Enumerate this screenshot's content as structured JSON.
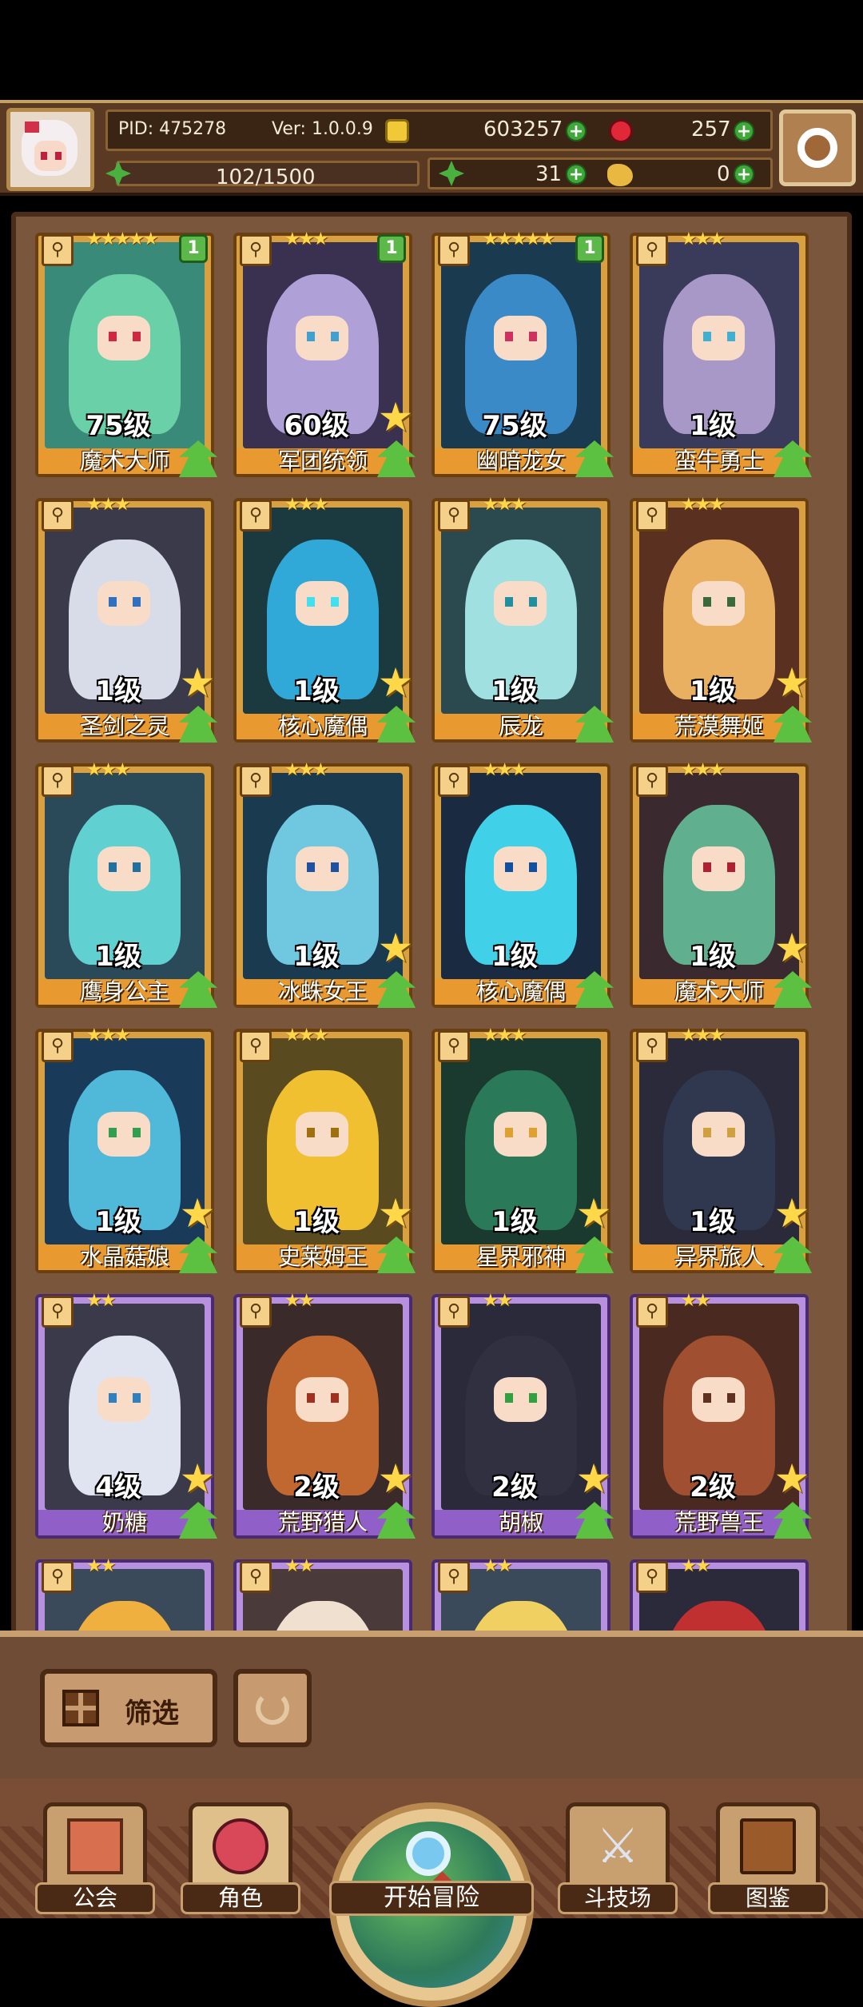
{
  "header": {
    "pid_label": "PID: 475278",
    "version_label": "Ver: 1.0.0.9",
    "gold": "603257",
    "gems": "257",
    "stamina": "102/1500",
    "clover_count": "31",
    "bread_count": "0"
  },
  "cards": [
    {
      "level": "75级",
      "name": "魔术大师",
      "stars": "★★★★★",
      "badge": "1",
      "rarity": "gold",
      "art_color": "#3a8a7a",
      "char_color": "#6ad0a8",
      "eye_color": "#d02840",
      "show_star": false
    },
    {
      "level": "60级",
      "name": "军团统领",
      "stars": "★★★",
      "badge": "1",
      "rarity": "gold",
      "art_color": "#3a3050",
      "char_color": "#b0a0d8",
      "eye_color": "#40a0d0",
      "show_star": true
    },
    {
      "level": "75级",
      "name": "幽暗龙女",
      "stars": "★★★★★",
      "badge": "1",
      "rarity": "gold",
      "art_color": "#1a3a50",
      "char_color": "#3a8ac8",
      "eye_color": "#d03060",
      "show_star": false
    },
    {
      "level": "1级",
      "name": "蛮牛勇士",
      "stars": "★★★",
      "badge": "",
      "rarity": "gold",
      "art_color": "#3a3a5a",
      "char_color": "#a898c8",
      "eye_color": "#40b0d0",
      "show_star": false
    },
    {
      "level": "1级",
      "name": "圣剑之灵",
      "stars": "★★★",
      "badge": "",
      "rarity": "gold",
      "art_color": "#3a3a4a",
      "char_color": "#d8dce8",
      "eye_color": "#3070c0",
      "show_star": true
    },
    {
      "level": "1级",
      "name": "核心魔偶",
      "stars": "★★★",
      "badge": "",
      "rarity": "gold",
      "art_color": "#1a3a40",
      "char_color": "#30a8d8",
      "eye_color": "#40e0f0",
      "show_star": true
    },
    {
      "level": "1级",
      "name": "辰龙",
      "stars": "★★★",
      "badge": "",
      "rarity": "gold",
      "art_color": "#2a4a50",
      "char_color": "#a0e0e0",
      "eye_color": "#2090a0",
      "show_star": false
    },
    {
      "level": "1级",
      "name": "荒漠舞姬",
      "stars": "★★★",
      "badge": "",
      "rarity": "gold",
      "art_color": "#5a3020",
      "char_color": "#e8b060",
      "eye_color": "#3a6a3a",
      "show_star": true
    },
    {
      "level": "1级",
      "name": "鹰身公主",
      "stars": "★★★",
      "badge": "",
      "rarity": "gold",
      "art_color": "#2a4a5a",
      "char_color": "#60d0d0",
      "eye_color": "#2070a0",
      "show_star": false
    },
    {
      "level": "1级",
      "name": "冰蛛女王",
      "stars": "★★★",
      "badge": "",
      "rarity": "gold",
      "art_color": "#1a3a50",
      "char_color": "#70c8e0",
      "eye_color": "#2050a0",
      "show_star": true
    },
    {
      "level": "1级",
      "name": "核心魔偶",
      "stars": "★★★",
      "badge": "",
      "rarity": "gold",
      "art_color": "#1a2a40",
      "char_color": "#40d0e8",
      "eye_color": "#1050a0",
      "show_star": false
    },
    {
      "level": "1级",
      "name": "魔术大师",
      "stars": "★★★",
      "badge": "",
      "rarity": "gold",
      "art_color": "#3a2a30",
      "char_color": "#60b090",
      "eye_color": "#b02030",
      "show_star": true
    },
    {
      "level": "1级",
      "name": "水晶菇娘",
      "stars": "★★★",
      "badge": "",
      "rarity": "gold",
      "art_color": "#1a3a5a",
      "char_color": "#50b8d8",
      "eye_color": "#30a050",
      "show_star": true
    },
    {
      "level": "1级",
      "name": "史莱姆王",
      "stars": "★★★",
      "badge": "",
      "rarity": "gold",
      "art_color": "#5a4a20",
      "char_color": "#f0c030",
      "eye_color": "#a07010",
      "show_star": true
    },
    {
      "level": "1级",
      "name": "星界邪神",
      "stars": "★★★",
      "badge": "",
      "rarity": "gold",
      "art_color": "#1a3a30",
      "char_color": "#2a7a5a",
      "eye_color": "#e0a030",
      "show_star": true
    },
    {
      "level": "1级",
      "name": "异界旅人",
      "stars": "★★★",
      "badge": "",
      "rarity": "gold",
      "art_color": "#2a2a3a",
      "char_color": "#303850",
      "eye_color": "#d0a040",
      "show_star": true
    },
    {
      "level": "4级",
      "name": "奶糖",
      "stars": "★★",
      "badge": "",
      "rarity": "purple",
      "art_color": "#3a3a4a",
      "char_color": "#e0e4f0",
      "eye_color": "#3080c0",
      "show_star": true
    },
    {
      "level": "2级",
      "name": "荒野猎人",
      "stars": "★★",
      "badge": "",
      "rarity": "purple",
      "art_color": "#3a2a2a",
      "char_color": "#c06830",
      "eye_color": "#a03020",
      "show_star": true
    },
    {
      "level": "2级",
      "name": "胡椒",
      "stars": "★★",
      "badge": "",
      "rarity": "purple",
      "art_color": "#2a2a3a",
      "char_color": "#303040",
      "eye_color": "#30a040",
      "show_star": true
    },
    {
      "level": "2级",
      "name": "荒野兽王",
      "stars": "★★",
      "badge": "",
      "rarity": "purple",
      "art_color": "#4a2a20",
      "char_color": "#a05030",
      "eye_color": "#603020",
      "show_star": true
    },
    {
      "level": "",
      "name": "",
      "stars": "★★",
      "badge": "",
      "rarity": "purple",
      "art_color": "#3a4a5a",
      "char_color": "#f0b040",
      "eye_color": "#3080c0",
      "show_star": false
    },
    {
      "level": "",
      "name": "",
      "stars": "★★",
      "badge": "",
      "rarity": "purple",
      "art_color": "#4a3a3a",
      "char_color": "#f0e0d0",
      "eye_color": "#3080c0",
      "show_star": false
    },
    {
      "level": "",
      "name": "",
      "stars": "★★",
      "badge": "",
      "rarity": "purple",
      "art_color": "#3a4a5a",
      "char_color": "#f0d060",
      "eye_color": "#3080c0",
      "show_star": false
    },
    {
      "level": "",
      "name": "",
      "stars": "★★",
      "badge": "",
      "rarity": "purple",
      "art_color": "#2a2a3a",
      "char_color": "#c03030",
      "eye_color": "#3080c0",
      "show_star": false
    }
  ],
  "controls": {
    "filter_label": "筛选"
  },
  "nav": {
    "guild": "公会",
    "characters": "角色",
    "adventure": "开始冒险",
    "arena": "斗技场",
    "codex": "图鉴"
  }
}
